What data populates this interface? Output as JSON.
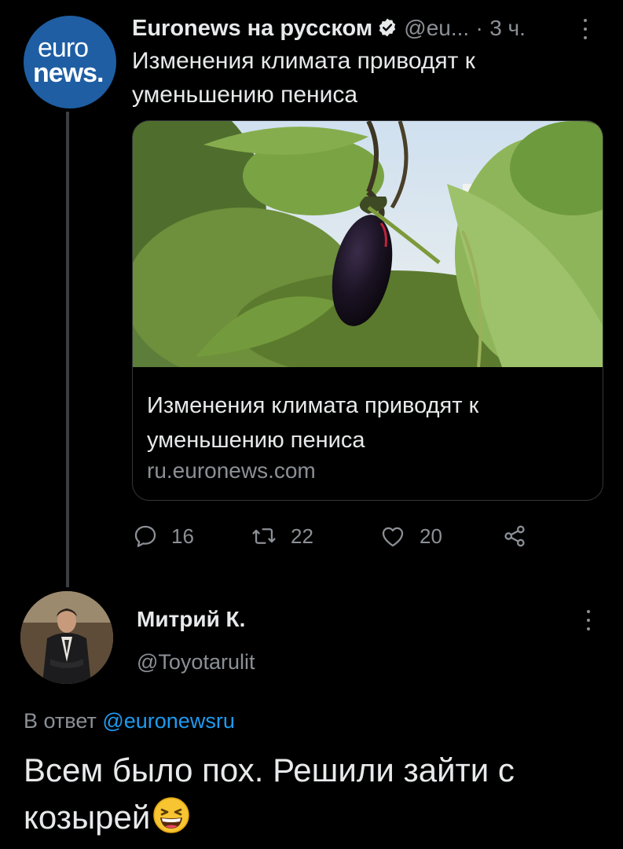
{
  "tweet": {
    "author_name": "Euronews на русском",
    "author_handle": "@eu...",
    "separator": "·",
    "time": "3 ч.",
    "avatar_logo_line1": "euro",
    "avatar_logo_line2": "news.",
    "text": "Изменения климата приводят к уменьшению пениса",
    "card": {
      "title": "Изменения климата приводят к уменьшению пениса",
      "domain": "ru.euronews.com",
      "image_icon": "eggplant-photo"
    },
    "actions": {
      "replies": "16",
      "retweets": "22",
      "likes": "20"
    }
  },
  "reply": {
    "author_name": "Митрий К.",
    "author_handle": "@Toyotarulit",
    "reply_to_prefix": "В ответ",
    "reply_to_mention": "@euronewsru",
    "text": "Всем было пох. Решили зайти с козырей",
    "emoji": "grinning-squinting-face"
  },
  "colors": {
    "background": "#000000",
    "text": "#e7e9ea",
    "muted": "#8b9096",
    "accent": "#1d9bf0",
    "verified": "#e7e9ea",
    "brand": "#1f5ea3"
  }
}
